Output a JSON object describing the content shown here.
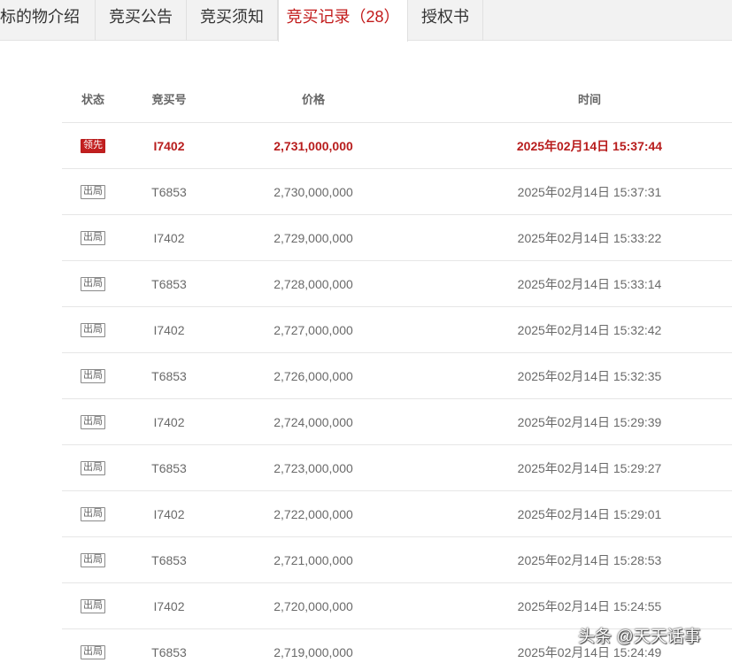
{
  "tabs": [
    {
      "label": "标的物介绍",
      "active": false
    },
    {
      "label": "竞买公告",
      "active": false
    },
    {
      "label": "竞买须知",
      "active": false
    },
    {
      "label": "竞买记录（28）",
      "active": true
    },
    {
      "label": "授权书",
      "active": false
    }
  ],
  "table": {
    "headers": {
      "status": "状态",
      "bidder_no": "竞买号",
      "price": "价格",
      "time": "时间"
    },
    "rows": [
      {
        "status": "领先",
        "bidder_no": "I7402",
        "price": "2,731,000,000",
        "time": "2025年02月14日 15:37:44"
      },
      {
        "status": "出局",
        "bidder_no": "T6853",
        "price": "2,730,000,000",
        "time": "2025年02月14日 15:37:31"
      },
      {
        "status": "出局",
        "bidder_no": "I7402",
        "price": "2,729,000,000",
        "time": "2025年02月14日 15:33:22"
      },
      {
        "status": "出局",
        "bidder_no": "T6853",
        "price": "2,728,000,000",
        "time": "2025年02月14日 15:33:14"
      },
      {
        "status": "出局",
        "bidder_no": "I7402",
        "price": "2,727,000,000",
        "time": "2025年02月14日 15:32:42"
      },
      {
        "status": "出局",
        "bidder_no": "T6853",
        "price": "2,726,000,000",
        "time": "2025年02月14日 15:32:35"
      },
      {
        "status": "出局",
        "bidder_no": "I7402",
        "price": "2,724,000,000",
        "time": "2025年02月14日 15:29:39"
      },
      {
        "status": "出局",
        "bidder_no": "T6853",
        "price": "2,723,000,000",
        "time": "2025年02月14日 15:29:27"
      },
      {
        "status": "出局",
        "bidder_no": "I7402",
        "price": "2,722,000,000",
        "time": "2025年02月14日 15:29:01"
      },
      {
        "status": "出局",
        "bidder_no": "T6853",
        "price": "2,721,000,000",
        "time": "2025年02月14日 15:28:53"
      },
      {
        "status": "出局",
        "bidder_no": "I7402",
        "price": "2,720,000,000",
        "time": "2025年02月14日 15:24:55"
      },
      {
        "status": "出局",
        "bidder_no": "T6853",
        "price": "2,719,000,000",
        "time": "2025年02月14日 15:24:49"
      }
    ]
  },
  "watermark": "头条 @天天话事",
  "colors": {
    "accent_red": "#c21a1a",
    "text_gray": "#6a6a6a",
    "tab_bar_bg": "#f2f2f2"
  }
}
